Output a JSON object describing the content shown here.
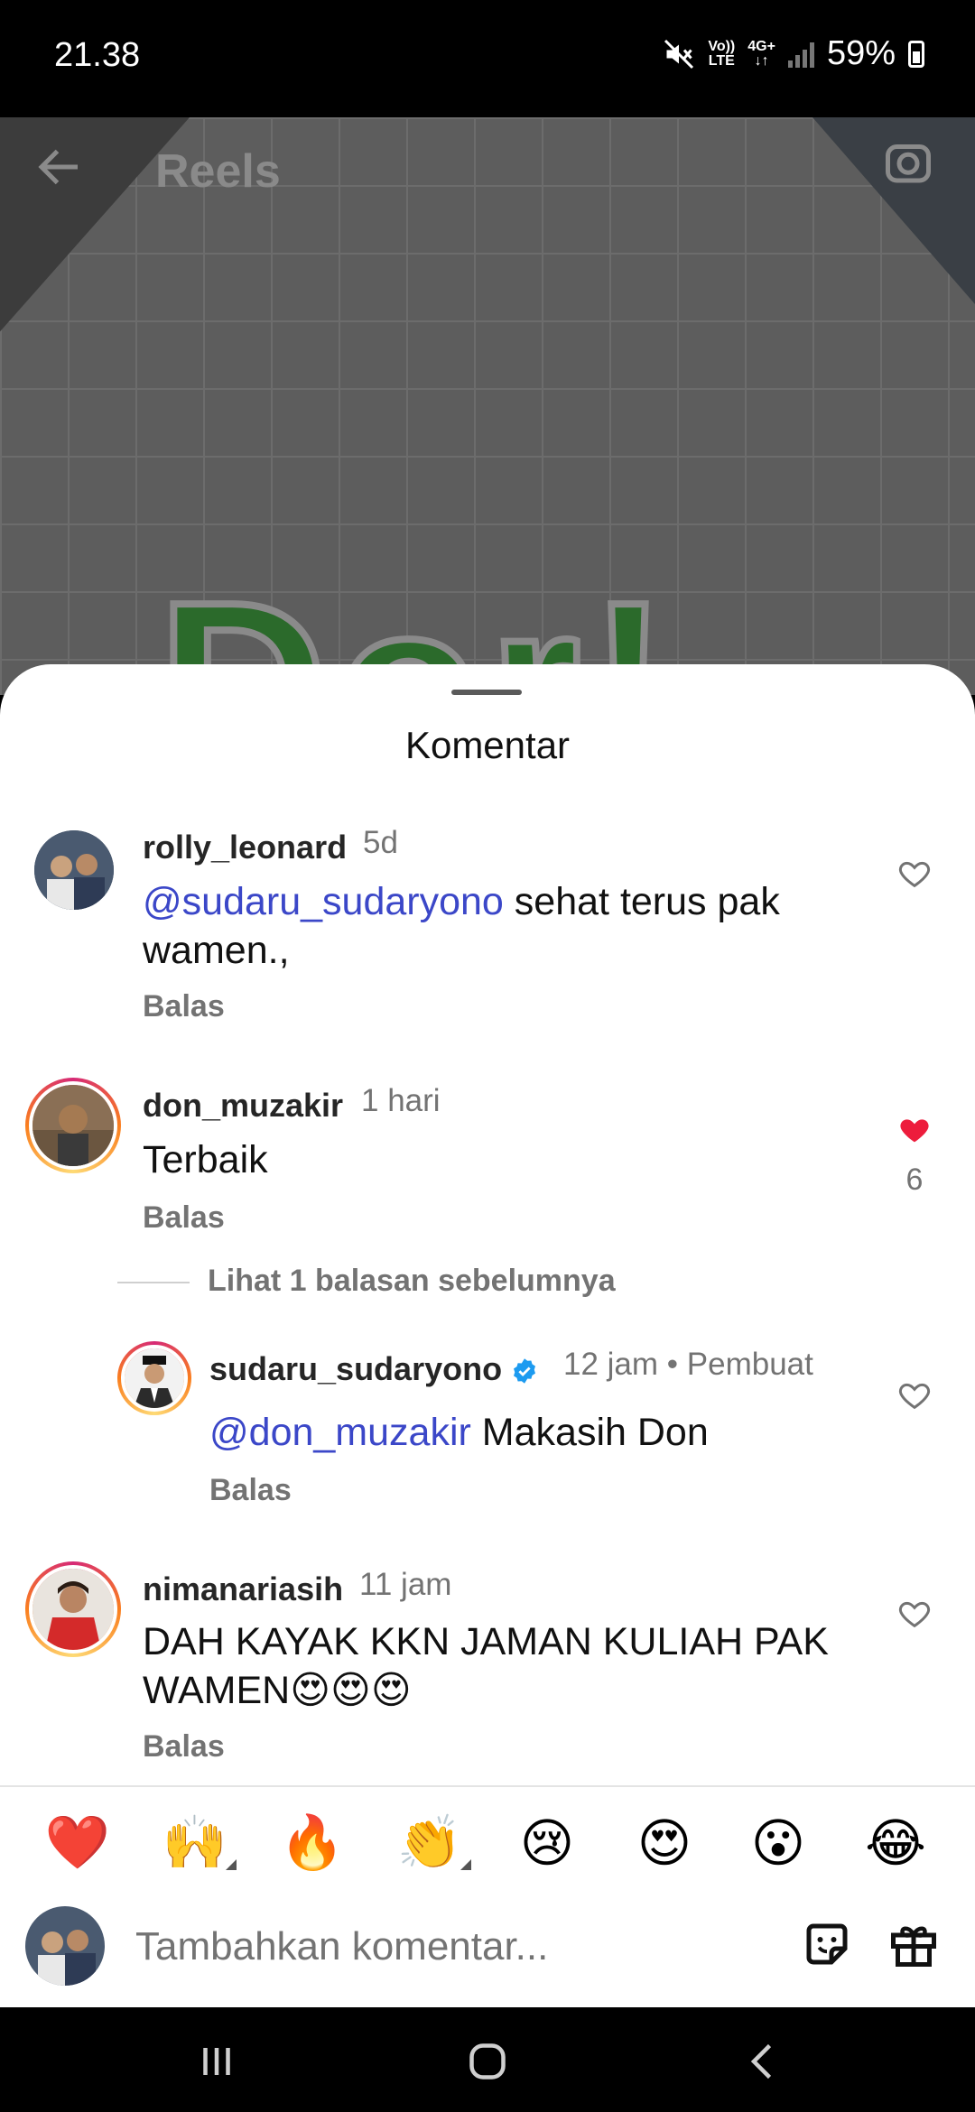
{
  "status_bar": {
    "time": "21.38",
    "volte_top": "Vo))",
    "volte_bottom": "LTE",
    "net_top": "4G+",
    "net_bottom": "↓↑",
    "battery": "59%"
  },
  "reel": {
    "header_title": "Reels",
    "overlay_text": "Dor!"
  },
  "sheet": {
    "title": "Komentar"
  },
  "comments": [
    {
      "username": "rolly_leonard",
      "time": "5d",
      "mention": "@sudaru_sudaryono",
      "text": " sehat terus pak wamen.,",
      "reply_label": "Balas",
      "liked": false
    },
    {
      "username": "don_muzakir",
      "time": "1 hari",
      "text": "Terbaik",
      "reply_label": "Balas",
      "liked": true,
      "like_count": "6"
    },
    {
      "username": "nimanariasih",
      "time": "11 jam",
      "text": "DAH KAYAK KKN JAMAN KULIAH PAK WAMEN😍😍😍",
      "reply_label": "Balas",
      "liked": false
    }
  ],
  "view_replies": "Lihat 1 balasan sebelumnya",
  "reply": {
    "username": "sudaru_sudaryono",
    "time": "12 jam",
    "badge": "Pembuat",
    "mention": "@don_muzakir",
    "text": " Makasih Don",
    "reply_label": "Balas"
  },
  "emoji_bar": [
    "❤️",
    "🙌",
    "🔥",
    "👏",
    "😢",
    "😍",
    "😮",
    "😂"
  ],
  "composer": {
    "placeholder": "Tambahkan komentar..."
  },
  "colors": {
    "mention": "#3b47c8",
    "like_red": "#ed1c3c",
    "verified": "#1d9bf0"
  }
}
